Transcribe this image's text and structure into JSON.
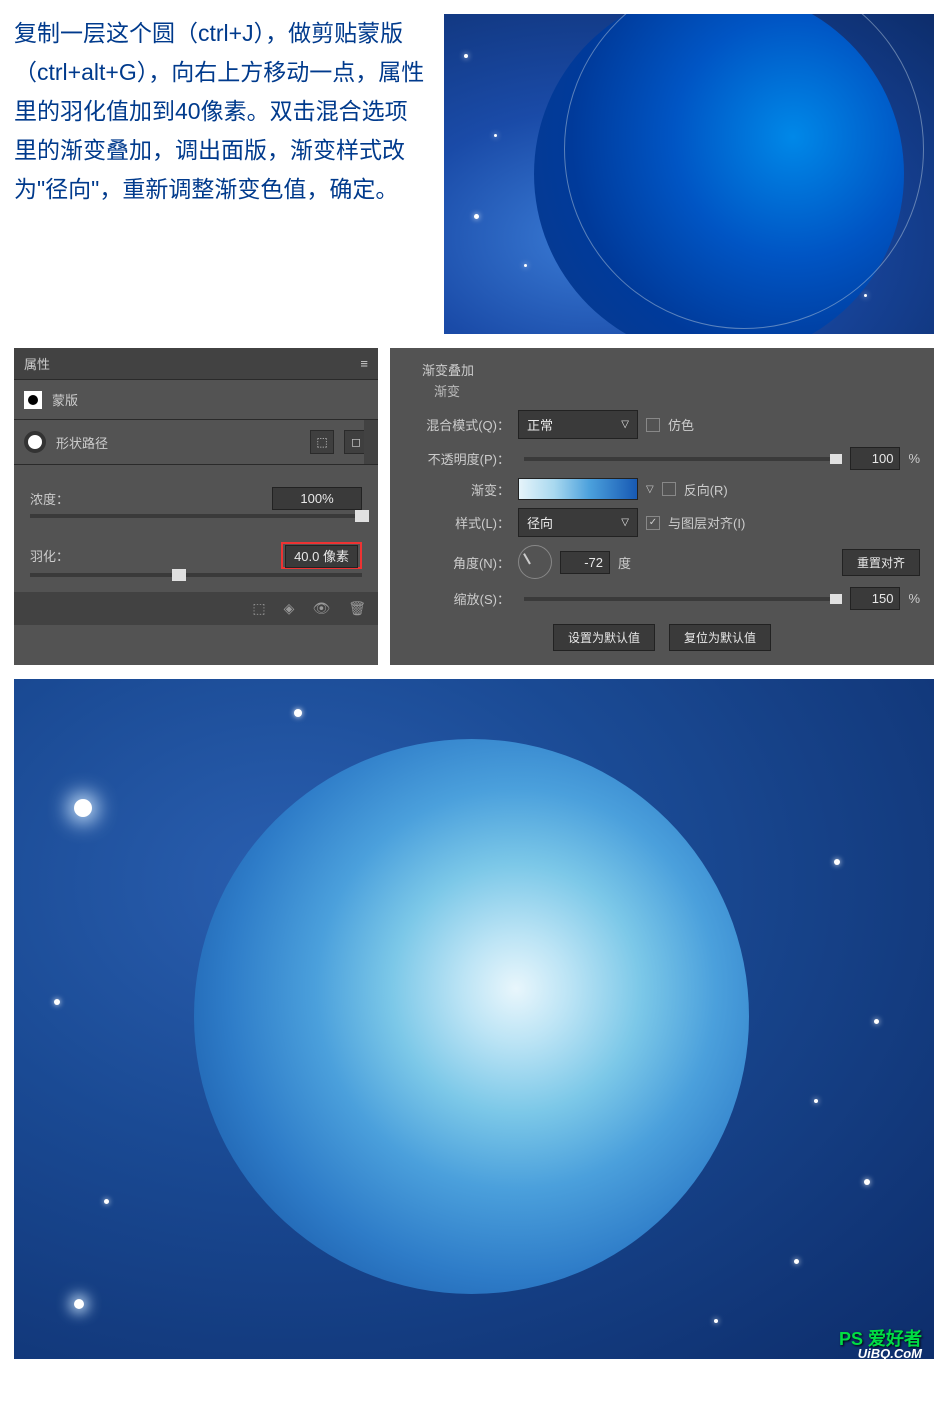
{
  "instruction_text": "复制一层这个圆（ctrl+J），做剪贴蒙版（ctrl+alt+G），向右上方移动一点，属性里的羽化值加到40像素。双击混合选项里的渐变叠加，调出面版，渐变样式改为\"径向\"，重新调整渐变色值，确定。",
  "properties_panel": {
    "title": "属性",
    "mask_label": "蒙版",
    "shape_path_label": "形状路径",
    "density_label": "浓度：",
    "density_value": "100%",
    "feather_label": "羽化：",
    "feather_value": "40.0 像素"
  },
  "gradient_overlay_panel": {
    "title": "渐变叠加",
    "subtitle": "渐变",
    "blend_mode_label": "混合模式(Q)：",
    "blend_mode_value": "正常",
    "dither_label": "仿色",
    "opacity_label": "不透明度(P)：",
    "opacity_value": "100",
    "opacity_unit": "%",
    "gradient_label": "渐变：",
    "reverse_label": "反向(R)",
    "style_label": "样式(L)：",
    "style_value": "径向",
    "align_label": "与图层对齐(I)",
    "align_checked": true,
    "angle_label": "角度(N)：",
    "angle_value": "-72",
    "angle_unit": "度",
    "reset_align_btn": "重置对齐",
    "scale_label": "缩放(S)：",
    "scale_value": "150",
    "scale_unit": "%",
    "default_btn": "设置为默认值",
    "reset_btn": "复位为默认值"
  },
  "watermark": {
    "line1": "PS 爱好者",
    "line2": "UiBQ.CoM"
  }
}
